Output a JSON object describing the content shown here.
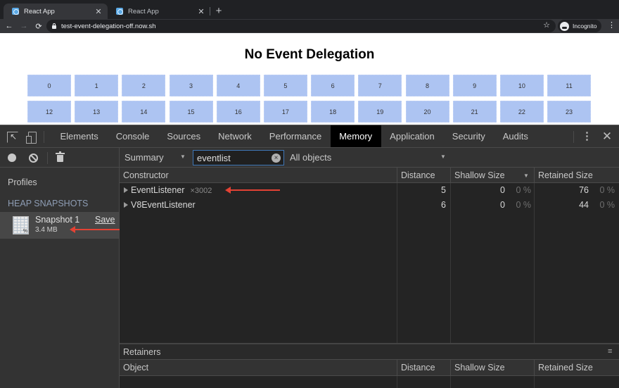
{
  "browser": {
    "tabs": [
      {
        "title": "React App",
        "active": true
      },
      {
        "title": "React App",
        "active": false
      }
    ],
    "close_glyph": "✕",
    "new_tab_glyph": "+",
    "back_glyph": "←",
    "forward_glyph": "→",
    "reload_glyph": "⟳",
    "url": "test-event-delegation-off.now.sh",
    "star_glyph": "☆",
    "profile_label": "Incognito",
    "menu_glyph": "⋮"
  },
  "page": {
    "title": "No Event Delegation",
    "cells": [
      "0",
      "1",
      "2",
      "3",
      "4",
      "5",
      "6",
      "7",
      "8",
      "9",
      "10",
      "11",
      "12",
      "13",
      "14",
      "15",
      "16",
      "17",
      "18",
      "19",
      "20",
      "21",
      "22",
      "23"
    ],
    "cell_color": "#adc4f2"
  },
  "devtools": {
    "tabs": [
      "Elements",
      "Console",
      "Sources",
      "Network",
      "Performance",
      "Memory",
      "Application",
      "Security",
      "Audits"
    ],
    "active_tab": "Memory",
    "kebab_glyph": "⋮",
    "close_glyph": "✕",
    "profiles": {
      "title": "Profiles",
      "section": "HEAP SNAPSHOTS",
      "snapshot": {
        "name": "Snapshot 1",
        "size": "3.4 MB",
        "save_label": "Save"
      }
    },
    "toolbar": {
      "view": "Summary",
      "caret": "▼",
      "filter_value": "eventlist",
      "clear_glyph": "×",
      "class_filter": "All objects"
    },
    "table": {
      "headers": [
        "Constructor",
        "Distance",
        "Shallow Size",
        "Retained Size"
      ],
      "sort_caret": "▼",
      "rows": [
        {
          "name": "EventListener",
          "count": "×3002",
          "distance": "5",
          "shallow": "0",
          "shallow_pct": "0 %",
          "retained": "76",
          "retained_pct": "0 %"
        },
        {
          "name": "V8EventListener",
          "count": "",
          "distance": "6",
          "shallow": "0",
          "shallow_pct": "0 %",
          "retained": "44",
          "retained_pct": "0 %"
        }
      ]
    },
    "retainers": {
      "title": "Retainers",
      "menu_glyph": "≡",
      "headers": [
        "Object",
        "Distance",
        "Shallow Size",
        "Retained Size"
      ]
    },
    "annotation_color": "#e34234"
  }
}
